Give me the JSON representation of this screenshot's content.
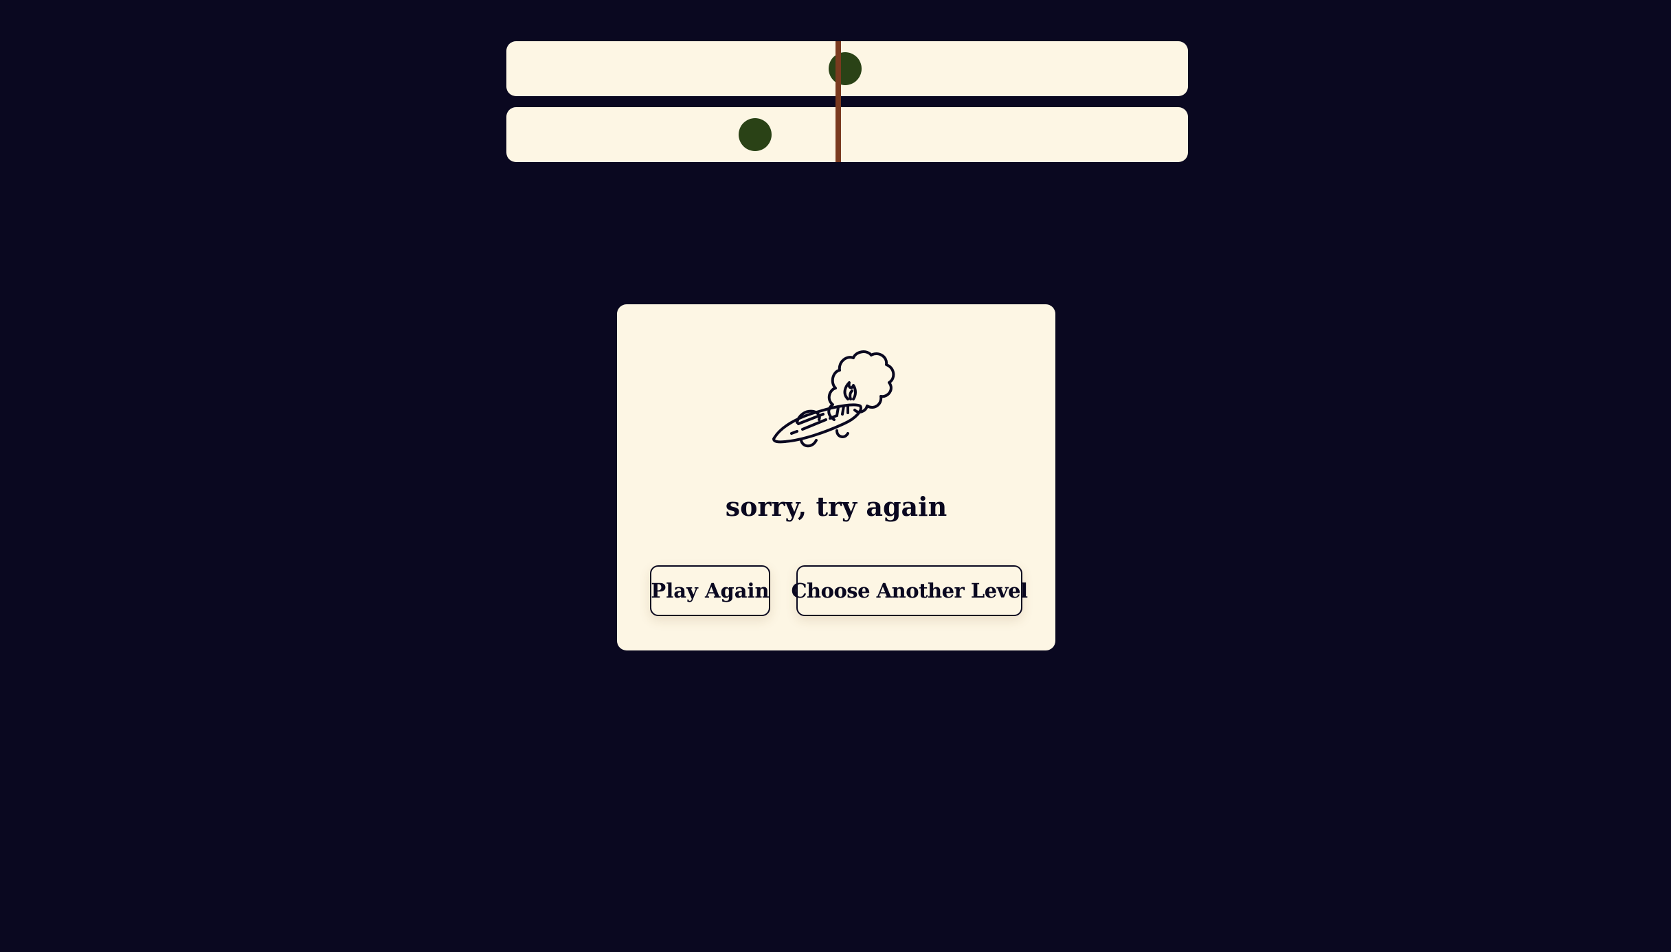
{
  "colors": {
    "background": "#0a0820",
    "panel": "#fdf6e4",
    "ball": "#2a4216",
    "marker": "#7a3a1f",
    "ink": "#0a0820"
  },
  "game": {
    "tracks": [
      {
        "ball_position": 0.497
      },
      {
        "ball_position": 0.365
      }
    ],
    "target_position": 0.487
  },
  "result": {
    "illustration_icon": "crashed-ufo-icon",
    "message": "sorry, try again",
    "play_again_label": "Play Again",
    "choose_level_label": "Choose Another Level"
  }
}
